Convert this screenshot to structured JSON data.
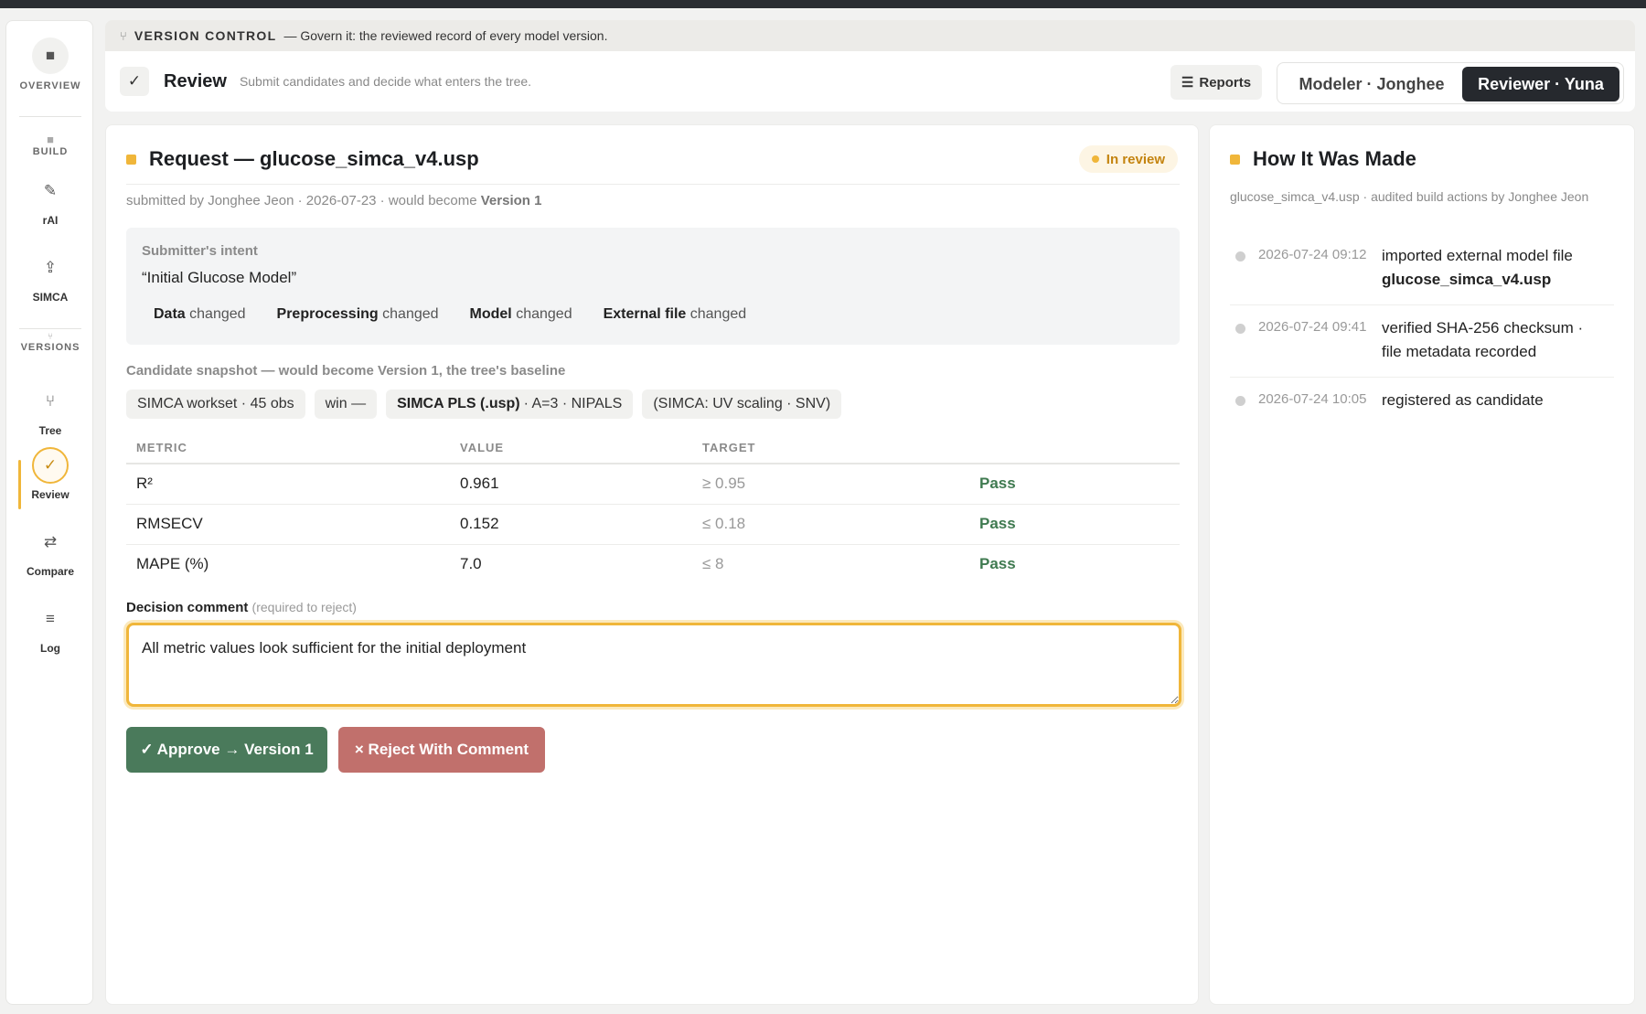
{
  "header": {
    "section_title": "VERSION CONTROL",
    "section_subtitle": "— Govern it: the reviewed record of every model version.",
    "page_title": "Review",
    "page_subtitle": "Submit candidates and decide what enters the tree.",
    "reports_label": "Reports",
    "roles": [
      {
        "label": "Modeler · Jonghee",
        "active": false
      },
      {
        "label": "Reviewer · Yuna",
        "active": true
      }
    ]
  },
  "sidebar": {
    "overview_label": "OVERVIEW",
    "build_group": "BUILD",
    "versions_group": "VERSIONS",
    "items": [
      {
        "label": "rAI",
        "icon": "pencil-icon"
      },
      {
        "label": "SIMCA",
        "icon": "upload-icon"
      },
      {
        "label": "Tree",
        "icon": "fork-icon"
      },
      {
        "label": "Review",
        "icon": "check-icon",
        "active": true
      },
      {
        "label": "Compare",
        "icon": "arrows-icon"
      },
      {
        "label": "Log",
        "icon": "list-icon"
      }
    ]
  },
  "request": {
    "title": "Request — glucose_simca_v4.usp",
    "status": "In review",
    "meta_prefix": "submitted by Jonghee Jeon · 2026-07-23 · would become ",
    "meta_version": "Version 1",
    "intent_label": "Submitter's intent",
    "intent_quote": "“Initial Glucose Model”",
    "changes": [
      {
        "name": "Data",
        "suffix": "changed"
      },
      {
        "name": "Preprocessing",
        "suffix": "changed"
      },
      {
        "name": "Model",
        "suffix": "changed"
      },
      {
        "name": "External file",
        "suffix": "changed"
      }
    ],
    "snapshot_title": "Candidate snapshot — would become Version 1, the tree's baseline",
    "chips": [
      {
        "bold": "",
        "text": "SIMCA workset · 45 obs"
      },
      {
        "bold": "",
        "text": "win —"
      },
      {
        "bold": "SIMCA PLS (.usp)",
        "text": "· A=3 · NIPALS"
      },
      {
        "bold": "",
        "text": "(SIMCA: UV scaling · SNV)"
      }
    ],
    "table": {
      "headers": [
        "METRIC",
        "VALUE",
        "TARGET",
        ""
      ],
      "rows": [
        {
          "metric": "R²",
          "value": "0.961",
          "target": "≥ 0.95",
          "status": "Pass"
        },
        {
          "metric": "RMSECV",
          "value": "0.152",
          "target": "≤ 0.18",
          "status": "Pass"
        },
        {
          "metric": "MAPE (%)",
          "value": "7.0",
          "target": "≤ 8",
          "status": "Pass"
        }
      ]
    },
    "comment_label": "Decision comment",
    "comment_hint": "(required to reject)",
    "comment_value": "All metric values look sufficient for the initial deployment",
    "approve_label": "✓ Approve → Version 1",
    "reject_label": "× Reject With Comment"
  },
  "history": {
    "title": "How It Was Made",
    "meta": "glucose_simca_v4.usp · audited build actions by Jonghee Jeon",
    "events": [
      {
        "time": "2026-07-24 09:12",
        "text": "imported external model file",
        "bold": "glucose_simca_v4.usp"
      },
      {
        "time": "2026-07-24 09:41",
        "text": "verified SHA-256 checksum · file metadata recorded",
        "bold": ""
      },
      {
        "time": "2026-07-24 10:05",
        "text": "registered as candidate",
        "bold": ""
      }
    ]
  },
  "colors": {
    "accent": "#f0b63a",
    "approve": "#4a7a5b",
    "reject": "#c1706c",
    "pass": "#3f7a50"
  }
}
